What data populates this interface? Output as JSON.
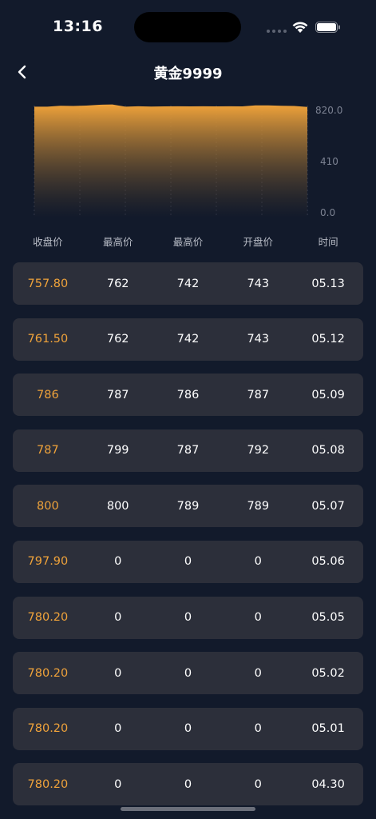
{
  "status_bar": {
    "time": "13:16"
  },
  "nav": {
    "title": "黄金9999"
  },
  "chart_data": {
    "type": "area",
    "y_ticks": [
      "820.0",
      "410",
      "0.0"
    ],
    "ylim": [
      0,
      820
    ],
    "values": [
      812,
      812,
      818,
      817,
      820,
      826,
      828,
      812,
      815,
      813,
      814,
      815,
      814,
      815,
      814,
      815,
      814,
      822,
      822,
      818,
      817,
      810
    ],
    "fill_top_color": "#f0a33a",
    "fill_bottom_color": "#121a2b",
    "grid": "vertical dashed"
  },
  "table": {
    "headers": [
      "收盘价",
      "最高价",
      "最高价",
      "开盘价",
      "时间"
    ],
    "rows": [
      [
        "757.80",
        "762",
        "742",
        "743",
        "05.13"
      ],
      [
        "761.50",
        "762",
        "742",
        "743",
        "05.12"
      ],
      [
        "786",
        "787",
        "786",
        "787",
        "05.09"
      ],
      [
        "787",
        "799",
        "787",
        "792",
        "05.08"
      ],
      [
        "800",
        "800",
        "789",
        "789",
        "05.07"
      ],
      [
        "797.90",
        "0",
        "0",
        "0",
        "05.06"
      ],
      [
        "780.20",
        "0",
        "0",
        "0",
        "05.05"
      ],
      [
        "780.20",
        "0",
        "0",
        "0",
        "05.02"
      ],
      [
        "780.20",
        "0",
        "0",
        "0",
        "05.01"
      ],
      [
        "780.20",
        "0",
        "0",
        "0",
        "04.30"
      ]
    ]
  },
  "colors": {
    "background": "#121a2b",
    "row_background": "#2c2f3a",
    "accent": "#f0a33a"
  }
}
